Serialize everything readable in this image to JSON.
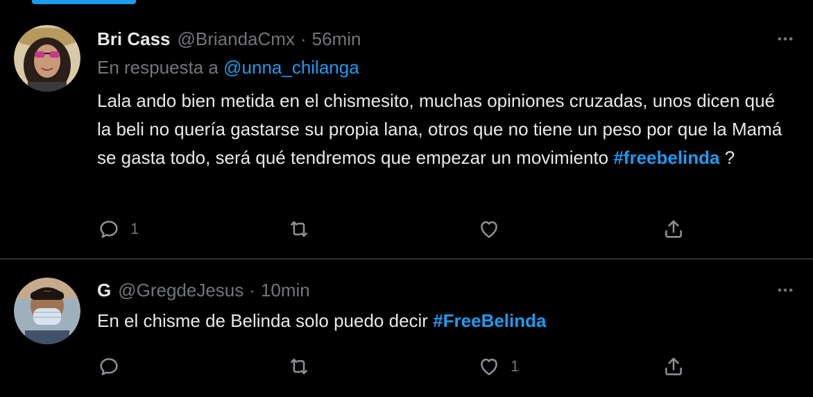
{
  "tweets": [
    {
      "display_name": "Bri Cass",
      "handle": "@BriandaCmx",
      "separator": "·",
      "time": "56min",
      "reply_prefix": "En respuesta a",
      "reply_mention": "@unna_chilanga",
      "text_main": "Lala ando bien metida en el chismesito, muchas opiniones cruzadas, unos dicen qué la beli no quería gastarse su propia lana, otros que no tiene un peso por que la Mamá se gasta todo, será qué tendremos que empezar un movimiento ",
      "hashtag": "#freebelinda",
      "text_after": " ?",
      "reply_count": "1",
      "retweet_count": "",
      "like_count": "",
      "icons": [
        "more-dots-icon",
        "reply-icon",
        "retweet-icon",
        "like-icon",
        "share-icon"
      ]
    },
    {
      "display_name": "G",
      "handle": "@GregdeJesus",
      "separator": "·",
      "time": "10min",
      "text_main": "En el chisme de Belinda solo puedo decir ",
      "hashtag": "#FreeBelinda",
      "reply_count": "",
      "retweet_count": "",
      "like_count": "1",
      "icons": [
        "more-dots-icon",
        "reply-icon",
        "retweet-icon",
        "like-icon",
        "share-icon"
      ]
    }
  ],
  "colors": {
    "background": "#000000",
    "accent": "#1d9bf0",
    "text": "#e7e9ea",
    "muted": "#71767b",
    "divider": "#2f3336"
  }
}
